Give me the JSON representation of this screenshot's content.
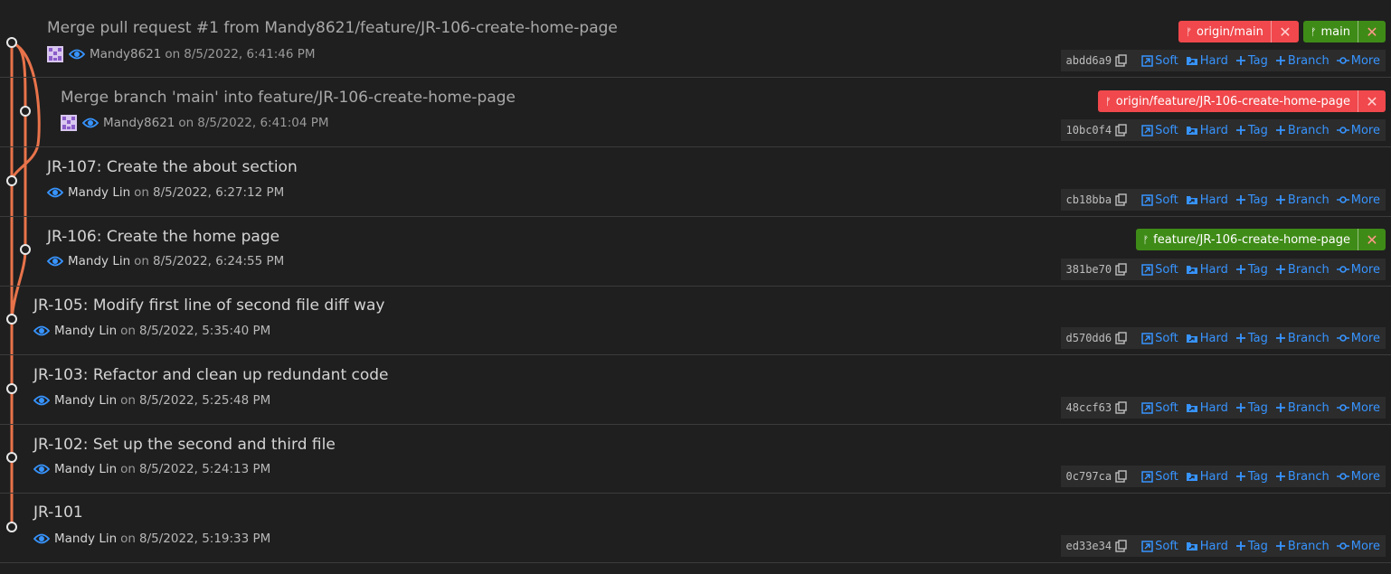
{
  "colors": {
    "graph_line": "#e8734a",
    "accent_link": "#3794ff",
    "tag_remote": "#f0484c",
    "tag_local": "#3f8b17"
  },
  "actions": {
    "soft": "Soft",
    "hard": "Hard",
    "tag": "Tag",
    "branch": "Branch",
    "more": "More"
  },
  "commits": [
    {
      "title": "Merge pull request #1 from Mandy8621/feature/JR-106-create-home-page",
      "author": "Mandy8621",
      "on": "on",
      "date": "8/5/2022, 6:41:46 PM",
      "hash": "abdd6a9",
      "tags": [
        {
          "label": "origin/main",
          "kind": "remote"
        },
        {
          "label": "main",
          "kind": "local"
        }
      ]
    },
    {
      "title": "Merge branch 'main' into feature/JR-106-create-home-page",
      "author": "Mandy8621",
      "on": "on",
      "date": "8/5/2022, 6:41:04 PM",
      "hash": "10bc0f4",
      "tags": [
        {
          "label": "origin/feature/JR-106-create-home-page",
          "kind": "remote"
        }
      ]
    },
    {
      "title": "JR-107: Create the about section",
      "author": "Mandy Lin",
      "on": "on",
      "date": "8/5/2022, 6:27:12 PM",
      "hash": "cb18bba",
      "tags": []
    },
    {
      "title": "JR-106: Create the home page",
      "author": "Mandy Lin",
      "on": "on",
      "date": "8/5/2022, 6:24:55 PM",
      "hash": "381be70",
      "tags": [
        {
          "label": "feature/JR-106-create-home-page",
          "kind": "local"
        }
      ]
    },
    {
      "title": "JR-105: Modify first line of second file diff way",
      "author": "Mandy Lin",
      "on": "on",
      "date": "8/5/2022, 5:35:40 PM",
      "hash": "d570dd6",
      "tags": []
    },
    {
      "title": "JR-103: Refactor and clean up redundant code",
      "author": "Mandy Lin",
      "on": "on",
      "date": "8/5/2022, 5:25:48 PM",
      "hash": "48ccf63",
      "tags": []
    },
    {
      "title": "JR-102: Set up the second and third file",
      "author": "Mandy Lin",
      "on": "on",
      "date": "8/5/2022, 5:24:13 PM",
      "hash": "0c797ca",
      "tags": []
    },
    {
      "title": "JR-101",
      "author": "Mandy Lin",
      "on": "on",
      "date": "8/5/2022, 5:19:33 PM",
      "hash": "ed33e34",
      "tags": []
    }
  ]
}
